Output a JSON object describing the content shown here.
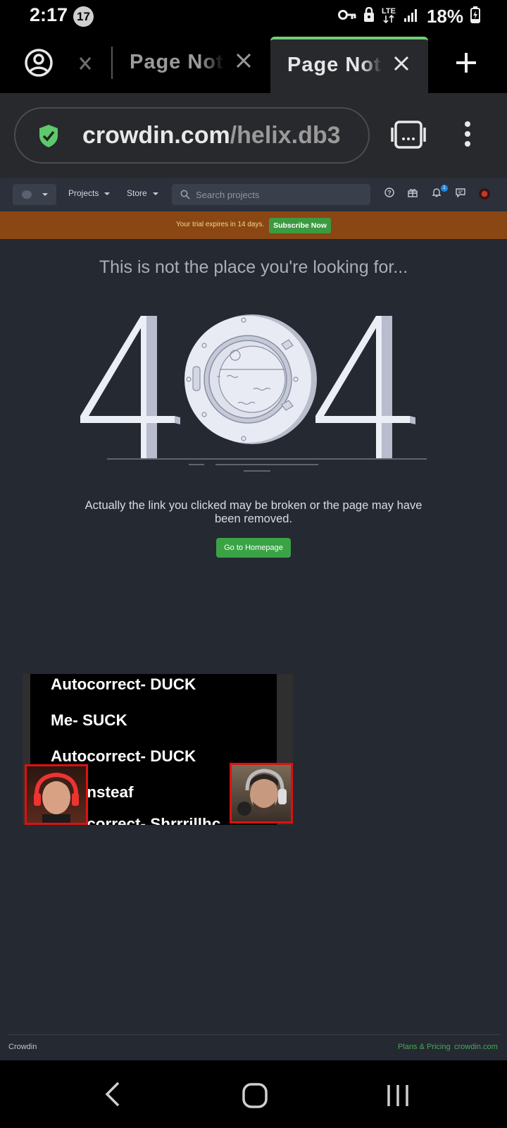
{
  "status_bar": {
    "time": "2:17",
    "notification_count": "17",
    "network": "LTE",
    "battery": "18%"
  },
  "tabs": {
    "inactive_title": "Page Not Found",
    "active_title": "Page Not Found",
    "accent_color": "#6fcf76"
  },
  "url_bar": {
    "domain": "crowdin.com",
    "path": "/helix.db3"
  },
  "crowdin_nav": {
    "projects_label": "Projects",
    "store_label": "Store",
    "search_placeholder": "Search projects",
    "notification_badge": "1"
  },
  "trial_banner": {
    "text": "Your trial expires in 14 days.",
    "button_label": "Subscribe Now"
  },
  "error_page": {
    "headline": "This is not the place you're looking for...",
    "code_left": "4",
    "code_right": "4",
    "description": "Actually the link you clicked may be broken or the page may have been removed.",
    "button_label": "Go to Homepage"
  },
  "video_overlay": {
    "lines": [
      "Autocorrect- DUCK",
      "Me- SUCK",
      "Autocorrect- DUCK",
      "Me- Insteaf",
      "Autocorrect- Shrrrillhc"
    ]
  },
  "footer": {
    "brand": "Crowdin",
    "plans_link": "Plans & Pricing",
    "site_link": "crowdin.com"
  }
}
